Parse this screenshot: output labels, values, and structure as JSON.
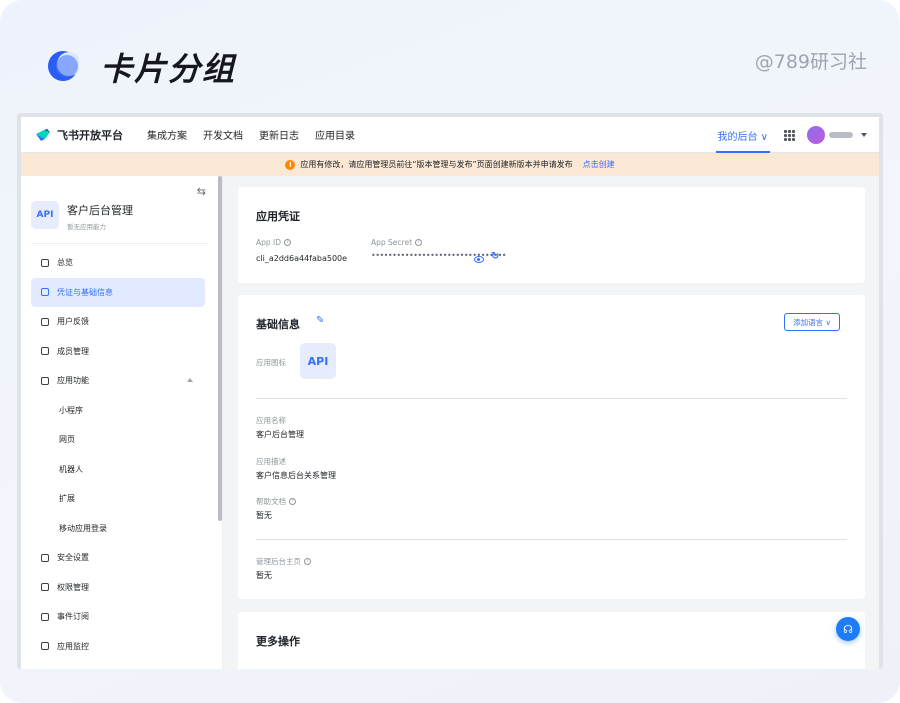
{
  "header": {
    "title": "卡片分组",
    "watermark": "@789研习社"
  },
  "topnav": {
    "brand": "飞书开放平台",
    "links": [
      "集成方案",
      "开发文档",
      "更新日志",
      "应用目录"
    ],
    "console_label": "我的后台 ∨"
  },
  "banner": {
    "message": "应用有修改，请应用管理员前往“版本管理与发布”页面创建新版本并申请发布",
    "link": "点击创建"
  },
  "sidebar": {
    "badge": "API",
    "app_name": "客户后台管理",
    "app_sub": "暂无应用能力",
    "items": [
      {
        "label": "总览"
      },
      {
        "label": "凭证与基础信息"
      },
      {
        "label": "用户反馈"
      },
      {
        "label": "成员管理"
      },
      {
        "label": "应用功能"
      },
      {
        "label": "小程序"
      },
      {
        "label": "网页"
      },
      {
        "label": "机器人"
      },
      {
        "label": "扩展"
      },
      {
        "label": "移动应用登录"
      },
      {
        "label": "安全设置"
      },
      {
        "label": "权限管理"
      },
      {
        "label": "事件订阅"
      },
      {
        "label": "应用监控"
      }
    ]
  },
  "credentials": {
    "title": "应用凭证",
    "app_id_label": "App ID",
    "app_id_value": "cli_a2dd6a44faba500e",
    "secret_label": "App Secret",
    "secret_value": "••••••••••••••••••••••••••••••••"
  },
  "basic": {
    "title": "基础信息",
    "add_language": "添加语言 ∨",
    "icon_label": "应用图标",
    "icon_text": "API",
    "name_label": "应用名称",
    "name_value": "客户后台管理",
    "desc_label": "应用描述",
    "desc_value": "客户信息后台关系管理",
    "help_label": "帮助文档",
    "help_value": "暂无",
    "home_label": "管理后台主页",
    "home_value": "暂无"
  },
  "more": {
    "title": "更多操作"
  }
}
